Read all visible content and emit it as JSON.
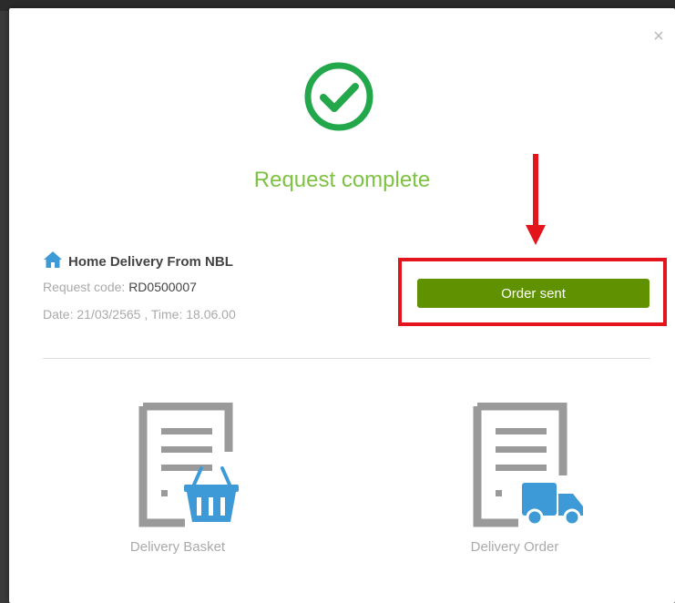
{
  "modal": {
    "close_glyph": "×",
    "title": "Request complete",
    "home_delivery_label": "Home Delivery From NBL",
    "request_code_label": "Request code:",
    "request_code_value": "RD0500007",
    "date_label": "Date:",
    "date_value": "21/03/2565",
    "time_label": ", Time:",
    "time_value": "18.06.00",
    "order_button_label": "Order sent",
    "cards": [
      {
        "label": "Delivery Basket",
        "icon": "basket-icon"
      },
      {
        "label": "Delivery Order",
        "icon": "truck-icon"
      }
    ]
  },
  "colors": {
    "success_green": "#7dc242",
    "check_green": "#22a74a",
    "button_green": "#5f9100",
    "highlight_red": "#e3141b",
    "icon_blue": "#3e9ad6",
    "doc_gray": "#9a9a9a"
  }
}
